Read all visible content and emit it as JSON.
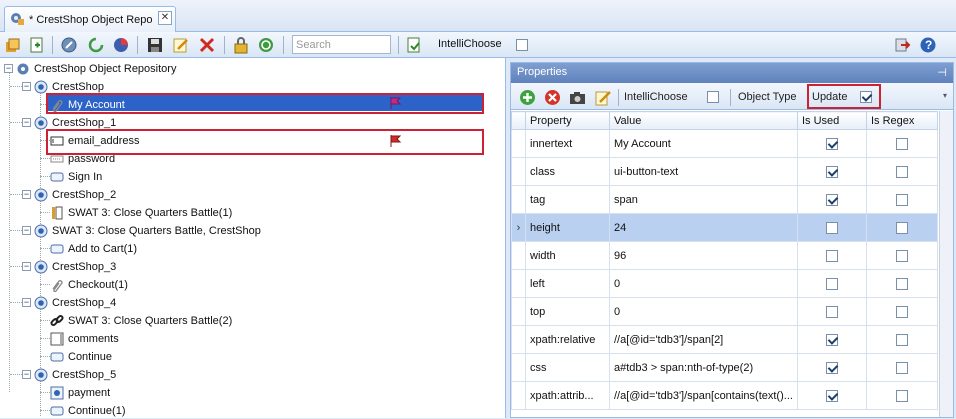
{
  "tab": {
    "title": "* CrestShop Object Repo",
    "close_glyph": "✕"
  },
  "toolbar": {
    "search_placeholder": "Search",
    "intellichoose_label": "IntelliChoose",
    "intellichoose_checked": false,
    "help_glyph": "?"
  },
  "tree": {
    "root": "CrestShop Object Repository",
    "nodes": [
      {
        "label": "CrestShop",
        "level": 1,
        "icon": "page-node-icon"
      },
      {
        "label": "My Account",
        "level": 2,
        "icon": "link-node-icon",
        "selected": true
      },
      {
        "label": "CrestShop_1",
        "level": 1,
        "icon": "page-node-icon"
      },
      {
        "label": "email_address",
        "level": 2,
        "icon": "textbox-node-icon"
      },
      {
        "label": "password",
        "level": 2,
        "icon": "password-node-icon"
      },
      {
        "label": "Sign In",
        "level": 2,
        "icon": "button-node-icon"
      },
      {
        "label": "CrestShop_2",
        "level": 1,
        "icon": "page-node-icon"
      },
      {
        "label": "SWAT 3: Close Quarters Battle(1)",
        "level": 2,
        "icon": "label-node-icon"
      },
      {
        "label": "SWAT 3: Close Quarters Battle, CrestShop",
        "level": 1,
        "icon": "page-node-icon"
      },
      {
        "label": "Add to Cart(1)",
        "level": 2,
        "icon": "button-node-icon"
      },
      {
        "label": "CrestShop_3",
        "level": 1,
        "icon": "page-node-icon"
      },
      {
        "label": "Checkout(1)",
        "level": 2,
        "icon": "link-node-icon"
      },
      {
        "label": "CrestShop_4",
        "level": 1,
        "icon": "page-node-icon"
      },
      {
        "label": "SWAT 3: Close Quarters Battle(2)",
        "level": 2,
        "icon": "chain-link-icon"
      },
      {
        "label": "comments",
        "level": 2,
        "icon": "textarea-node-icon"
      },
      {
        "label": "Continue",
        "level": 2,
        "icon": "button-node-icon"
      },
      {
        "label": "CrestShop_5",
        "level": 1,
        "icon": "page-node-icon"
      },
      {
        "label": "payment",
        "level": 2,
        "icon": "radio-node-icon"
      },
      {
        "label": "Continue(1)",
        "level": 2,
        "icon": "button-node-icon"
      }
    ]
  },
  "properties": {
    "title": "Properties",
    "pin_glyph": "⊣",
    "intellichoose_label": "IntelliChoose",
    "intellichoose_checked": false,
    "object_type_label": "Object Type",
    "update_label": "Update",
    "update_checked": true,
    "columns": [
      "Property",
      "Value",
      "Is Used",
      "Is Regex"
    ],
    "rows": [
      {
        "property": "innertext",
        "value": "My Account",
        "is_used": true,
        "is_regex": false
      },
      {
        "property": "class",
        "value": "ui-button-text",
        "is_used": true,
        "is_regex": false
      },
      {
        "property": "tag",
        "value": "span",
        "is_used": true,
        "is_regex": false
      },
      {
        "property": "height",
        "value": "24",
        "is_used": false,
        "is_regex": false,
        "active": true
      },
      {
        "property": "width",
        "value": "96",
        "is_used": false,
        "is_regex": false
      },
      {
        "property": "left",
        "value": "0",
        "is_used": false,
        "is_regex": false
      },
      {
        "property": "top",
        "value": "0",
        "is_used": false,
        "is_regex": false
      },
      {
        "property": "xpath:relative",
        "value": "//a[@id='tdb3']/span[2]",
        "is_used": true,
        "is_regex": false
      },
      {
        "property": "css",
        "value": "a#tdb3 > span:nth-of-type(2)",
        "is_used": true,
        "is_regex": false
      },
      {
        "property": "xpath:attrib...",
        "value": "//a[@id='tdb3']/span[contains(text()...",
        "is_used": true,
        "is_regex": false
      }
    ],
    "active_marker": "›"
  }
}
